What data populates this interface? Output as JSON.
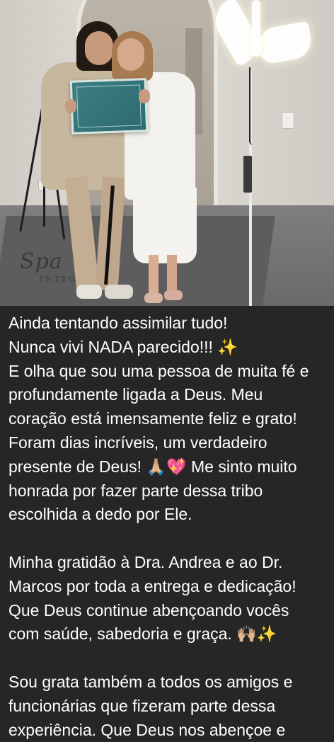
{
  "photo": {
    "rug_text": "Spa",
    "rug_subtext": "INTEGR"
  },
  "caption": {
    "paragraph1": [
      "Ainda tentando assimilar tudo!",
      "Nunca vivi NADA parecido!!! ✨",
      "E olha que sou uma pessoa de muita fé e",
      "profundamente ligada a Deus. Meu",
      "coração está imensamente feliz e grato!",
      "Foram dias incríveis, um verdadeiro",
      "presente de Deus! 🙏🏼💖 Me sinto muito",
      "honrada por fazer parte dessa tribo",
      "escolhida a dedo por Ele."
    ],
    "paragraph2": [
      "Minha gratidão à Dra. Andrea e ao Dr.",
      "Marcos por toda a entrega e dedicação!",
      "Que Deus continue abençoando vocês",
      "com saúde, sabedoria e graça. 🙌🏼✨"
    ],
    "paragraph3": [
      "Sou grata também a todos os amigos e",
      "funcionárias que fizeram parte dessa",
      "experiência. Que Deus nos abençoe e"
    ]
  },
  "colors": {
    "background": "#262626",
    "text": "#ffffff"
  }
}
